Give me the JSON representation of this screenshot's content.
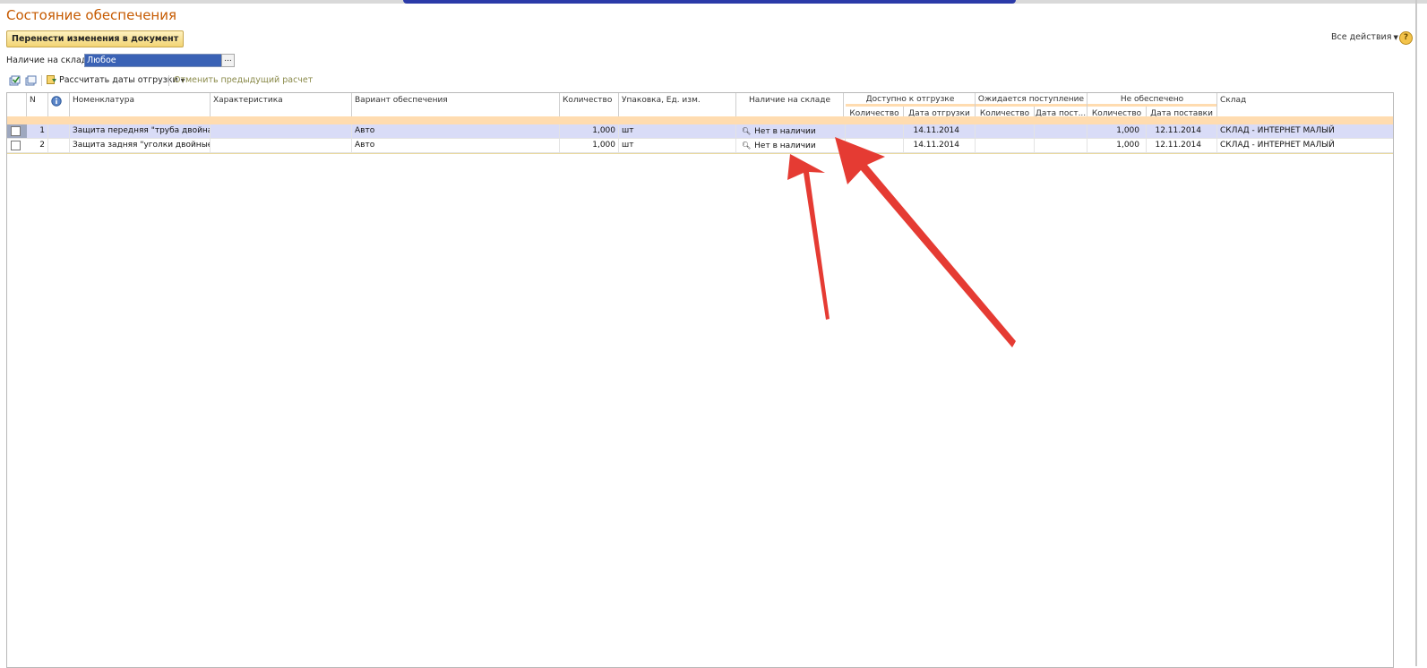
{
  "window": {
    "title": "Состояние обеспечения",
    "transfer_button": "Перенести изменения в документ",
    "all_actions": "Все действия",
    "help_icon": "?"
  },
  "filter": {
    "label": "Наличие на складе:",
    "value": "Любое",
    "select_button": "..."
  },
  "toolbar": {
    "calc_dates": "Рассчитать даты отгрузки",
    "cancel_previous": "Отменить предыдущий расчет"
  },
  "table": {
    "headers": {
      "n": "N",
      "nomenclature": "Номенклатура",
      "characteristic": "Характеристика",
      "variant": "Вариант обеспечения",
      "quantity": "Количество",
      "package": "Упаковка, Ед. изм.",
      "stock": "Наличие на складе",
      "available_group": "Доступно к отгрузке",
      "available_qty": "Количество",
      "available_date": "Дата отгрузки",
      "expected_group": "Ожидается поступление",
      "expected_qty": "Количество",
      "expected_date": "Дата пост...",
      "unprovided_group": "Не обеспечено",
      "unprovided_qty": "Количество",
      "unprovided_date": "Дата поставки",
      "warehouse": "Склад"
    },
    "rows": [
      {
        "n": "1",
        "nomenclature": "Защита передняя \"труба двойная-...",
        "characteristic": "",
        "variant": "Авто",
        "quantity": "1,000",
        "package": "шт",
        "stock": "Нет в наличии",
        "available_qty": "",
        "available_date": "14.11.2014",
        "expected_qty": "",
        "expected_date": "",
        "unprovided_qty": "1,000",
        "unprovided_date": "12.11.2014",
        "warehouse": "СКЛАД - ИНТЕРНЕТ МАЛЫЙ"
      },
      {
        "n": "2",
        "nomenclature": "Защита задняя \"уголки двойные\"...",
        "characteristic": "",
        "variant": "Авто",
        "quantity": "1,000",
        "package": "шт",
        "stock": "Нет в наличии",
        "available_qty": "",
        "available_date": "14.11.2014",
        "expected_qty": "",
        "expected_date": "",
        "unprovided_qty": "1,000",
        "unprovided_date": "12.11.2014",
        "warehouse": "СКЛАД - ИНТЕРНЕТ МАЛЫЙ"
      }
    ]
  },
  "colors": {
    "title": "#c65a00",
    "header_stripe": "#ffdcb0",
    "selected_row": "#d9dcf7",
    "annotation_arrow": "#e53b33"
  }
}
